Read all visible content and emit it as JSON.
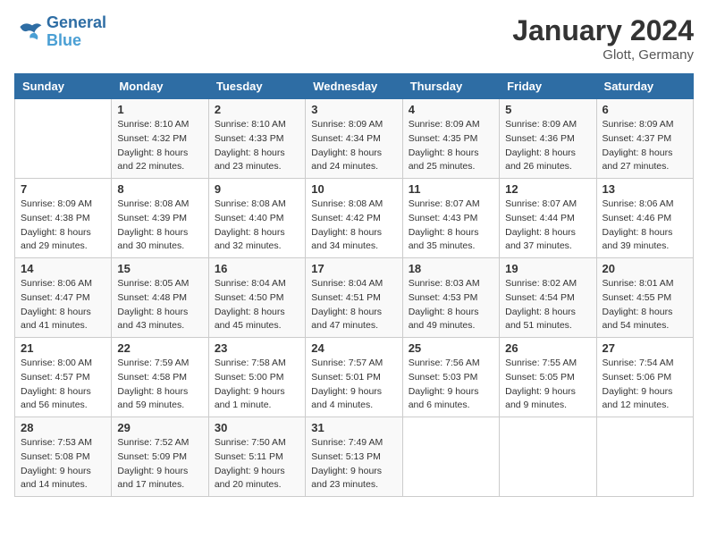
{
  "logo": {
    "line1": "General",
    "line2": "Blue"
  },
  "title": "January 2024",
  "location": "Glott, Germany",
  "days_header": [
    "Sunday",
    "Monday",
    "Tuesday",
    "Wednesday",
    "Thursday",
    "Friday",
    "Saturday"
  ],
  "weeks": [
    [
      {
        "day": "",
        "sunrise": "",
        "sunset": "",
        "daylight": ""
      },
      {
        "day": "1",
        "sunrise": "Sunrise: 8:10 AM",
        "sunset": "Sunset: 4:32 PM",
        "daylight": "Daylight: 8 hours and 22 minutes."
      },
      {
        "day": "2",
        "sunrise": "Sunrise: 8:10 AM",
        "sunset": "Sunset: 4:33 PM",
        "daylight": "Daylight: 8 hours and 23 minutes."
      },
      {
        "day": "3",
        "sunrise": "Sunrise: 8:09 AM",
        "sunset": "Sunset: 4:34 PM",
        "daylight": "Daylight: 8 hours and 24 minutes."
      },
      {
        "day": "4",
        "sunrise": "Sunrise: 8:09 AM",
        "sunset": "Sunset: 4:35 PM",
        "daylight": "Daylight: 8 hours and 25 minutes."
      },
      {
        "day": "5",
        "sunrise": "Sunrise: 8:09 AM",
        "sunset": "Sunset: 4:36 PM",
        "daylight": "Daylight: 8 hours and 26 minutes."
      },
      {
        "day": "6",
        "sunrise": "Sunrise: 8:09 AM",
        "sunset": "Sunset: 4:37 PM",
        "daylight": "Daylight: 8 hours and 27 minutes."
      }
    ],
    [
      {
        "day": "7",
        "sunrise": "Sunrise: 8:09 AM",
        "sunset": "Sunset: 4:38 PM",
        "daylight": "Daylight: 8 hours and 29 minutes."
      },
      {
        "day": "8",
        "sunrise": "Sunrise: 8:08 AM",
        "sunset": "Sunset: 4:39 PM",
        "daylight": "Daylight: 8 hours and 30 minutes."
      },
      {
        "day": "9",
        "sunrise": "Sunrise: 8:08 AM",
        "sunset": "Sunset: 4:40 PM",
        "daylight": "Daylight: 8 hours and 32 minutes."
      },
      {
        "day": "10",
        "sunrise": "Sunrise: 8:08 AM",
        "sunset": "Sunset: 4:42 PM",
        "daylight": "Daylight: 8 hours and 34 minutes."
      },
      {
        "day": "11",
        "sunrise": "Sunrise: 8:07 AM",
        "sunset": "Sunset: 4:43 PM",
        "daylight": "Daylight: 8 hours and 35 minutes."
      },
      {
        "day": "12",
        "sunrise": "Sunrise: 8:07 AM",
        "sunset": "Sunset: 4:44 PM",
        "daylight": "Daylight: 8 hours and 37 minutes."
      },
      {
        "day": "13",
        "sunrise": "Sunrise: 8:06 AM",
        "sunset": "Sunset: 4:46 PM",
        "daylight": "Daylight: 8 hours and 39 minutes."
      }
    ],
    [
      {
        "day": "14",
        "sunrise": "Sunrise: 8:06 AM",
        "sunset": "Sunset: 4:47 PM",
        "daylight": "Daylight: 8 hours and 41 minutes."
      },
      {
        "day": "15",
        "sunrise": "Sunrise: 8:05 AM",
        "sunset": "Sunset: 4:48 PM",
        "daylight": "Daylight: 8 hours and 43 minutes."
      },
      {
        "day": "16",
        "sunrise": "Sunrise: 8:04 AM",
        "sunset": "Sunset: 4:50 PM",
        "daylight": "Daylight: 8 hours and 45 minutes."
      },
      {
        "day": "17",
        "sunrise": "Sunrise: 8:04 AM",
        "sunset": "Sunset: 4:51 PM",
        "daylight": "Daylight: 8 hours and 47 minutes."
      },
      {
        "day": "18",
        "sunrise": "Sunrise: 8:03 AM",
        "sunset": "Sunset: 4:53 PM",
        "daylight": "Daylight: 8 hours and 49 minutes."
      },
      {
        "day": "19",
        "sunrise": "Sunrise: 8:02 AM",
        "sunset": "Sunset: 4:54 PM",
        "daylight": "Daylight: 8 hours and 51 minutes."
      },
      {
        "day": "20",
        "sunrise": "Sunrise: 8:01 AM",
        "sunset": "Sunset: 4:55 PM",
        "daylight": "Daylight: 8 hours and 54 minutes."
      }
    ],
    [
      {
        "day": "21",
        "sunrise": "Sunrise: 8:00 AM",
        "sunset": "Sunset: 4:57 PM",
        "daylight": "Daylight: 8 hours and 56 minutes."
      },
      {
        "day": "22",
        "sunrise": "Sunrise: 7:59 AM",
        "sunset": "Sunset: 4:58 PM",
        "daylight": "Daylight: 8 hours and 59 minutes."
      },
      {
        "day": "23",
        "sunrise": "Sunrise: 7:58 AM",
        "sunset": "Sunset: 5:00 PM",
        "daylight": "Daylight: 9 hours and 1 minute."
      },
      {
        "day": "24",
        "sunrise": "Sunrise: 7:57 AM",
        "sunset": "Sunset: 5:01 PM",
        "daylight": "Daylight: 9 hours and 4 minutes."
      },
      {
        "day": "25",
        "sunrise": "Sunrise: 7:56 AM",
        "sunset": "Sunset: 5:03 PM",
        "daylight": "Daylight: 9 hours and 6 minutes."
      },
      {
        "day": "26",
        "sunrise": "Sunrise: 7:55 AM",
        "sunset": "Sunset: 5:05 PM",
        "daylight": "Daylight: 9 hours and 9 minutes."
      },
      {
        "day": "27",
        "sunrise": "Sunrise: 7:54 AM",
        "sunset": "Sunset: 5:06 PM",
        "daylight": "Daylight: 9 hours and 12 minutes."
      }
    ],
    [
      {
        "day": "28",
        "sunrise": "Sunrise: 7:53 AM",
        "sunset": "Sunset: 5:08 PM",
        "daylight": "Daylight: 9 hours and 14 minutes."
      },
      {
        "day": "29",
        "sunrise": "Sunrise: 7:52 AM",
        "sunset": "Sunset: 5:09 PM",
        "daylight": "Daylight: 9 hours and 17 minutes."
      },
      {
        "day": "30",
        "sunrise": "Sunrise: 7:50 AM",
        "sunset": "Sunset: 5:11 PM",
        "daylight": "Daylight: 9 hours and 20 minutes."
      },
      {
        "day": "31",
        "sunrise": "Sunrise: 7:49 AM",
        "sunset": "Sunset: 5:13 PM",
        "daylight": "Daylight: 9 hours and 23 minutes."
      },
      {
        "day": "",
        "sunrise": "",
        "sunset": "",
        "daylight": ""
      },
      {
        "day": "",
        "sunrise": "",
        "sunset": "",
        "daylight": ""
      },
      {
        "day": "",
        "sunrise": "",
        "sunset": "",
        "daylight": ""
      }
    ]
  ]
}
